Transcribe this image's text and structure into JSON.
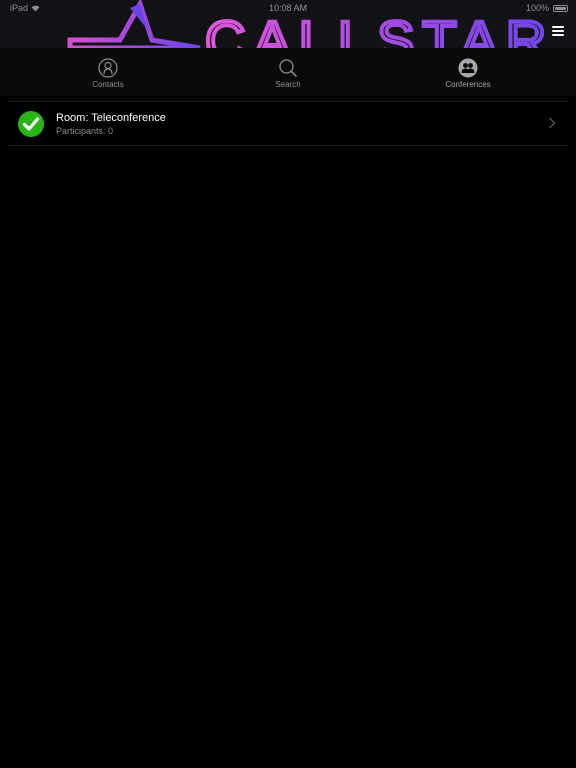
{
  "status_bar": {
    "carrier": "iPad",
    "time": "10:08 AM",
    "battery_text": "100%"
  },
  "header": {
    "logo_text": "CALLSTAR",
    "menu_icon": "hamburger-icon"
  },
  "tabs": [
    {
      "label": "Contacts",
      "icon": "contact-person-icon",
      "active": false
    },
    {
      "label": "Search",
      "icon": "search-icon",
      "active": false
    },
    {
      "label": "Conferences",
      "icon": "conferences-group-icon",
      "active": true
    }
  ],
  "conferences": [
    {
      "title": "Room: Teleconference",
      "subtitle": "Participants: 0",
      "status_icon": "green-check-icon"
    }
  ],
  "colors": {
    "background": "#000000",
    "header": "#131317",
    "check_green": "#2bb31a",
    "logo_pink": "#d64fd1",
    "logo_purple": "#7744e6",
    "text_secondary": "#8e8e93"
  }
}
